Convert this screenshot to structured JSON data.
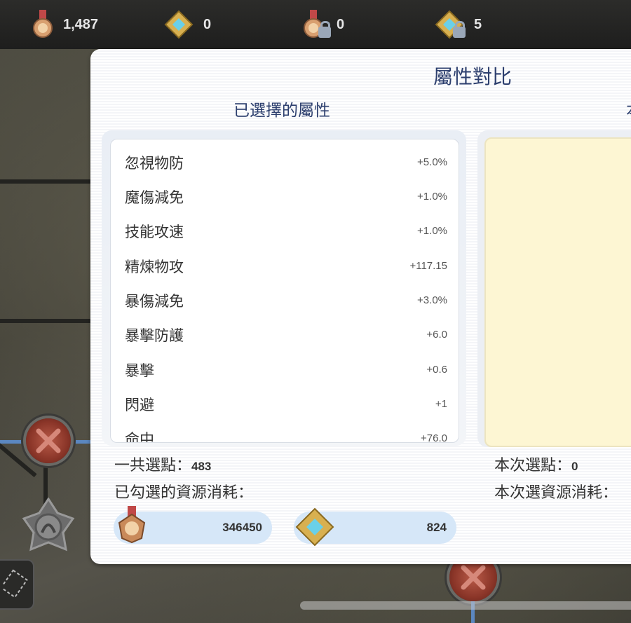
{
  "topbar": {
    "resources": [
      {
        "icon": "medal-icon",
        "value": "1,487"
      },
      {
        "icon": "gold-gem-icon",
        "value": "0"
      },
      {
        "icon": "locked-medal-icon",
        "value": "0"
      },
      {
        "icon": "locked-gold-gem-icon",
        "value": "5"
      }
    ]
  },
  "panel": {
    "title": "屬性對比",
    "left_title": "已選擇的屬性",
    "right_title_partial": "本",
    "attributes": [
      {
        "name": "忽視物防",
        "value": "+5.0%"
      },
      {
        "name": "魔傷減免",
        "value": "+1.0%"
      },
      {
        "name": "技能攻速",
        "value": "+1.0%"
      },
      {
        "name": "精煉物攻",
        "value": "+117.15"
      },
      {
        "name": "暴傷減免",
        "value": "+3.0%"
      },
      {
        "name": "暴擊防護",
        "value": "+6.0"
      },
      {
        "name": "暴擊",
        "value": "+0.6"
      },
      {
        "name": "閃避",
        "value": "+1"
      },
      {
        "name": "命中",
        "value": "+76.0"
      }
    ],
    "total_points_label": "一共選點：",
    "total_points_value": "483",
    "selected_cost_label": "已勾選的資源消耗：",
    "cost_medal": "346450",
    "cost_gem": "824",
    "this_points_label": "本次選點：",
    "this_points_value": "0",
    "this_cost_label": "本次選資源消耗："
  },
  "colors": {
    "title": "#2d3f6e",
    "pill": "#d6e7f8",
    "right_box": "#fdf6d3"
  }
}
